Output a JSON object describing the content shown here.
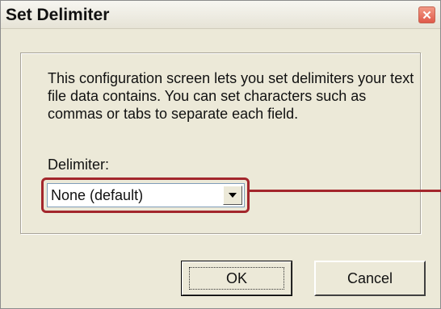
{
  "window": {
    "title": "Set Delimiter",
    "close_glyph": "✕"
  },
  "body": {
    "description": "This configuration screen lets you set delimiters your text file data contains. You can set characters such as commas or tabs to separate each field.",
    "delimiter_label": "Delimiter:",
    "delimiter_value": "None (default)"
  },
  "buttons": {
    "ok": "OK",
    "cancel": "Cancel"
  },
  "colors": {
    "highlight": "#a3262c",
    "dialog_bg": "#ece9d8"
  },
  "icons": {
    "close": "close-icon",
    "dropdown": "dropdown-arrow-icon"
  }
}
